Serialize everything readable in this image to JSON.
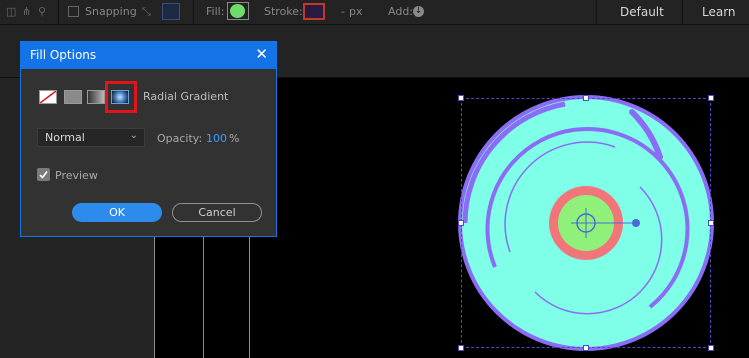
{
  "toolbar": {
    "snapping_label": "Snapping",
    "fill_label": "Fill:",
    "stroke_label": "Stroke:",
    "stroke_width": "-",
    "stroke_unit": "px",
    "add_label": "Add:",
    "workspaces": [
      "Default",
      "Learn"
    ]
  },
  "dialog": {
    "title": "Fill Options",
    "fill_type_label": "Radial Gradient",
    "blend_mode": "Normal",
    "opacity_label": "Opacity:",
    "opacity_value": "100",
    "opacity_unit": "%",
    "preview_label": "Preview",
    "preview_checked": true,
    "ok_label": "OK",
    "cancel_label": "Cancel",
    "selected_fill_type": "radial-gradient"
  },
  "colors": {
    "accent": "#1473e6",
    "highlight": "#e0151b",
    "shape_fill": "#7fffe8",
    "shape_stroke": "#8a6cf5",
    "ring": "#f2757a",
    "center": "#8ff07a"
  }
}
